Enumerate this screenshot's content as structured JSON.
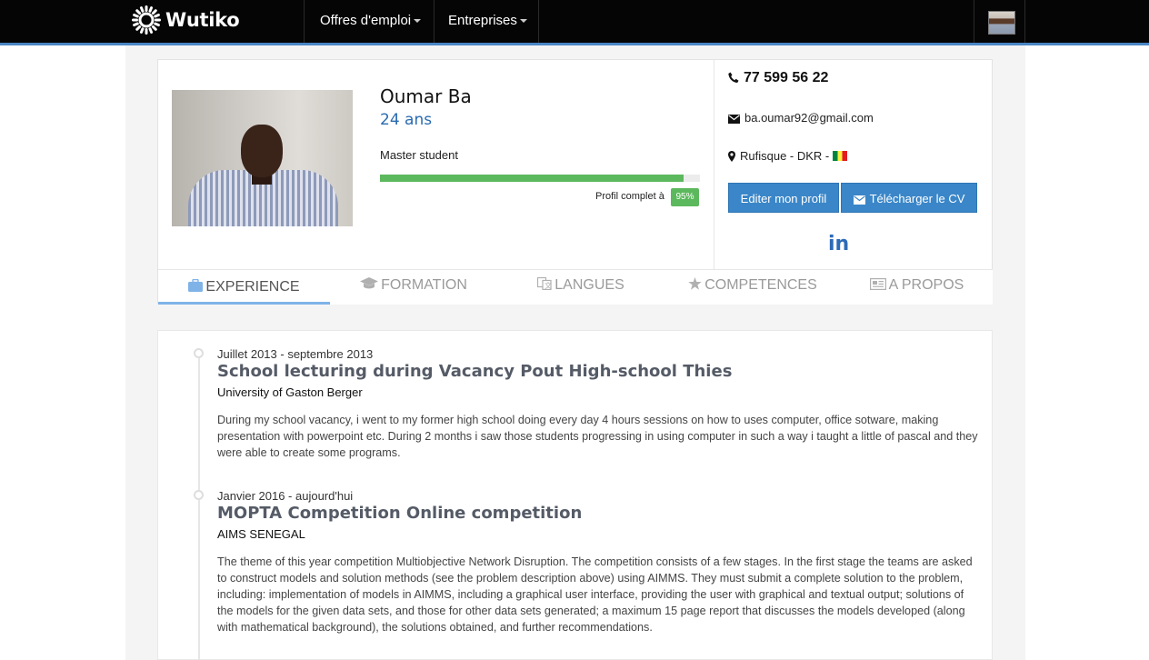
{
  "navbar": {
    "brand": "Wutiko",
    "menu": [
      {
        "label": "Offres d'emploi"
      },
      {
        "label": "Entreprises"
      }
    ]
  },
  "profile": {
    "name": "Oumar Ba",
    "age": "24 ans",
    "headline": "Master student",
    "completion_label": "Profil complet à",
    "completion_percent": 95,
    "completion_badge": "95%",
    "phone": "77 599 56 22",
    "email": "ba.oumar92@gmail.com",
    "location": "Rufisque - DKR -",
    "buttons": {
      "edit": "Editer mon profil",
      "download": "Télécharger le CV"
    },
    "social": "in"
  },
  "tabs": [
    {
      "label": "EXPERIENCE",
      "icon": "briefcase-icon",
      "active": true
    },
    {
      "label": "FORMATION",
      "icon": "graduation-cap-icon",
      "active": false
    },
    {
      "label": "LANGUES",
      "icon": "language-icon",
      "active": false
    },
    {
      "label": "COMPETENCES",
      "icon": "star-icon",
      "active": false
    },
    {
      "label": "A PROPOS",
      "icon": "newspaper-icon",
      "active": false
    }
  ],
  "experiences": [
    {
      "date": "Juillet 2013 - septembre 2013",
      "title": "School lecturing during Vacancy Pout High-school Thies",
      "company": "University of Gaston Berger",
      "description": "During my school vacancy, i went to my former high school doing every day 4 hours sessions on how to uses computer, office sotware, making presentation with powerpoint etc. During 2 months i saw those students progressing in using computer in such a way i taught a little of pascal and they were able to create some programs."
    },
    {
      "date": "Janvier 2016 - aujourd'hui",
      "title": "MOPTA Competition Online competition",
      "company": "AIMS SENEGAL",
      "description": "The theme of this year competition Multiobjective Network Disruption. The competition consists of a few stages. In the first stage the teams are asked to construct models and solution methods (see the problem description above) using AIMMS. They must submit a complete solution to the problem, including: implementation of models in AIMMS, including a graphical user interface, providing the user with graphical and textual output; solutions of the models for the given data sets, and those for other data sets generated; a maximum 15 page report that discusses the models developed (along with mathematical background), the solutions obtained, and further recommendations."
    }
  ],
  "colors": {
    "navbar": "#050505",
    "accent": "#3a86c8",
    "progress": "#5cb85c",
    "age": "#2a6bb0"
  }
}
